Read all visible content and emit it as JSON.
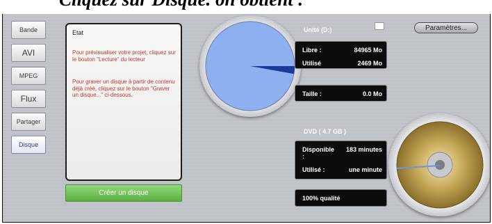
{
  "document": {
    "caption": "Cliquez sur Disque. on obtient :"
  },
  "tabs": [
    {
      "label": "Bande"
    },
    {
      "label": "AVI"
    },
    {
      "label": "MPEG"
    },
    {
      "label": "Flux"
    },
    {
      "label": "Partager"
    },
    {
      "label": "Disque",
      "active": true
    }
  ],
  "state_panel": {
    "title": "Etat",
    "paragraph1": "Pour prévisualiser votre projet, cliquez sur le bouton \"Lecture\" du lecteur",
    "paragraph2": "Pour graver un disque à partir de contenu déjà créé, cliquez sur le bouton \"Graver un disque...\" ci-dessous."
  },
  "create_button": {
    "label": "Créer un disque"
  },
  "unit": {
    "title": "Unité (D:)",
    "free_label": "Libre :",
    "free_value": "84965 Mo",
    "used_label": "Utilisé",
    "used_value": "2469 Mo",
    "size_label": "Taille :",
    "size_value": "0.0 Mo",
    "used_fraction": 0.028,
    "pie_color": "#8fb0f0"
  },
  "settings_button": {
    "label": "Paramètres..."
  },
  "dvd": {
    "title": "DVD ( 4.7 GB )",
    "available_label": "Disponible :",
    "available_value": "183 minutes",
    "used_label": "Utilisé :",
    "used_value": "une minute",
    "quality": "100% qualité"
  },
  "icons": {
    "folder": "folder-icon",
    "disc": "dvd-disc-icon",
    "pie": "disk-usage-pie"
  }
}
